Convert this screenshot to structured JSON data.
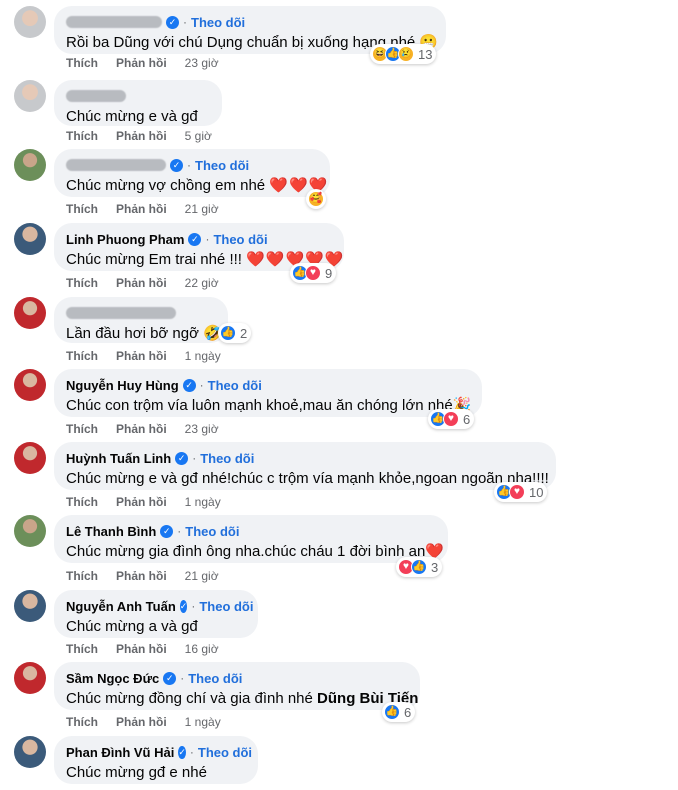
{
  "actions": {
    "like": "Thích",
    "reply": "Phản hồi"
  },
  "follow_label": "Theo dõi",
  "comments": [
    {
      "name": "",
      "text": "Rồi ba Dũng với chú Dụng chuẩn bị xuống hạng nhé",
      "emoji": "😬",
      "time": "23 giờ",
      "reaction_count": "13",
      "reactions": [
        "haha-icon",
        "like-icon",
        "sad-icon"
      ]
    },
    {
      "name": "",
      "text": "Chúc mừng e và gđ",
      "time": "5 giờ"
    },
    {
      "name": "",
      "text": "Chúc mừng vợ chồng em nhé",
      "emoji": "❤️❤️❤️",
      "time": "21 giờ",
      "reactions": [
        "care-icon"
      ]
    },
    {
      "name": "Linh Phuong Pham",
      "text": "Chúc mừng Em trai nhé !!!",
      "emoji": "❤️❤️❤️❤️❤️",
      "time": "22 giờ",
      "reaction_count": "9",
      "reactions": [
        "like-icon",
        "love-icon"
      ]
    },
    {
      "name": "",
      "text": "Lần đầu hơi bỡ ngỡ",
      "emoji": "🤣",
      "time": "1 ngày",
      "reaction_count": "2",
      "reactions": [
        "like-icon"
      ]
    },
    {
      "name": "Nguyễn Huy Hùng",
      "text": "Chúc con trộm vía luôn mạnh khoẻ,mau ăn chóng lớn nhé",
      "emoji": "🎉",
      "time": "23 giờ",
      "reaction_count": "6",
      "reactions": [
        "like-icon",
        "love-icon"
      ]
    },
    {
      "name": "Huỳnh Tuấn Linh",
      "text": "Chúc mừng e và gđ nhé!chúc c trộm vía mạnh khỏe,ngoan ngoãn nha!!!!",
      "time": "1 ngày",
      "reaction_count": "10",
      "reactions": [
        "like-icon",
        "love-icon"
      ]
    },
    {
      "name": "Lê Thanh Bình",
      "text": "Chúc mừng gia đình ông nha.chúc cháu 1 đời bình an",
      "emoji": "❤️",
      "time": "21 giờ",
      "reaction_count": "3",
      "reactions": [
        "love-icon",
        "like-icon"
      ]
    },
    {
      "name": "Nguyễn Anh Tuấn",
      "text": "Chúc mừng a và gđ",
      "time": "16 giờ"
    },
    {
      "name": "Sầm Ngọc Đức",
      "text": "Chúc mừng đồng chí và gia đình nhé",
      "mention": "Dũng Bùi Tiến",
      "time": "1 ngày",
      "reaction_count": "6",
      "reactions": [
        "like-icon"
      ]
    },
    {
      "name": "Phan Đình Vũ Hải",
      "text": "Chúc mừng gđ e nhé"
    }
  ]
}
